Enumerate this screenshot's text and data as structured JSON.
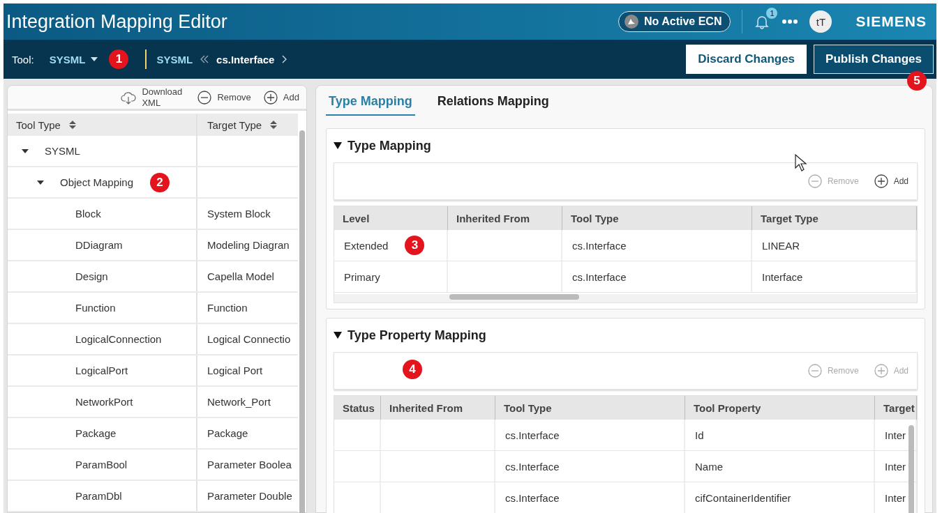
{
  "header": {
    "title": "Integration Mapping Editor",
    "ecn": "No Active ECN",
    "notifications": "1",
    "avatar": "tT",
    "brand": "SIEMENS"
  },
  "toolbar": {
    "tool_label": "Tool:",
    "tool": "SYSML",
    "tool_marker": "1",
    "breadcrumb": [
      "SYSML",
      "cs.Interface"
    ],
    "buttons": [
      {
        "label": "Discard Changes",
        "kind": "secondary"
      },
      {
        "label": "Publish Changes",
        "kind": "primary",
        "marker": "5"
      }
    ]
  },
  "left_panel": {
    "actions": [
      {
        "kind": "download",
        "label": "Download XML",
        "disabled": false
      },
      {
        "kind": "remove",
        "label": "Remove",
        "disabled": false
      },
      {
        "kind": "add",
        "label": "Add",
        "disabled": false
      }
    ],
    "columns": [
      "Tool Type",
      "Target Type"
    ],
    "tree": [
      {
        "tool_type": "SYSML",
        "expanded": true,
        "children": [
          {
            "tool_type": "Object Mapping",
            "expanded": true,
            "marker": "2",
            "children": [
              {
                "tool_type": "Block",
                "target_type": "System Block"
              },
              {
                "tool_type": "DDiagram",
                "target_type": "Modeling Diagran"
              },
              {
                "tool_type": "Design",
                "target_type": "Capella Model"
              },
              {
                "tool_type": "Function",
                "target_type": "Function"
              },
              {
                "tool_type": "LogicalConnection",
                "target_type": "Logical Connectio"
              },
              {
                "tool_type": "LogicalPort",
                "target_type": "Logical Port"
              },
              {
                "tool_type": "NetworkPort",
                "target_type": "Network_Port"
              },
              {
                "tool_type": "Package",
                "target_type": "Package"
              },
              {
                "tool_type": "ParamBool",
                "target_type": "Parameter Boolea"
              },
              {
                "tool_type": "ParamDbl",
                "target_type": "Parameter Double"
              }
            ]
          }
        ]
      }
    ]
  },
  "tabs": [
    {
      "label": "Type Mapping",
      "selected": true
    },
    {
      "label": "Relations Mapping",
      "selected": false
    }
  ],
  "sections": [
    {
      "title": "Type Mapping",
      "expanded": true,
      "actions": [
        {
          "kind": "remove",
          "label": "Remove",
          "disabled": true
        },
        {
          "kind": "add",
          "label": "Add",
          "disabled": false
        }
      ],
      "columns": [
        "Level",
        "Inherited From",
        "Tool Type",
        "Target Type"
      ],
      "rows": [
        {
          "level": "Extended",
          "tool_type": "cs.Interface",
          "target_type": "LINEAR",
          "marker": "3"
        },
        {
          "level": "Primary",
          "tool_type": "cs.Interface",
          "target_type": "Interface"
        }
      ]
    },
    {
      "title": "Type Property Mapping",
      "expanded": true,
      "toolbar_marker": "4",
      "actions": [
        {
          "kind": "remove",
          "label": "Remove",
          "disabled": true
        },
        {
          "kind": "add",
          "label": "Add",
          "disabled": true
        }
      ],
      "columns": [
        "Status",
        "Inherited From",
        "Tool Type",
        "Tool Property",
        "Target"
      ],
      "rows": [
        {
          "tool_type": "cs.Interface",
          "tool_property": "Id",
          "target": "Inter"
        },
        {
          "tool_type": "cs.Interface",
          "tool_property": "Name",
          "target": "Inter"
        },
        {
          "tool_type": "cs.Interface",
          "tool_property": "cifContainerIdentifier",
          "target": "Inter"
        }
      ]
    }
  ]
}
